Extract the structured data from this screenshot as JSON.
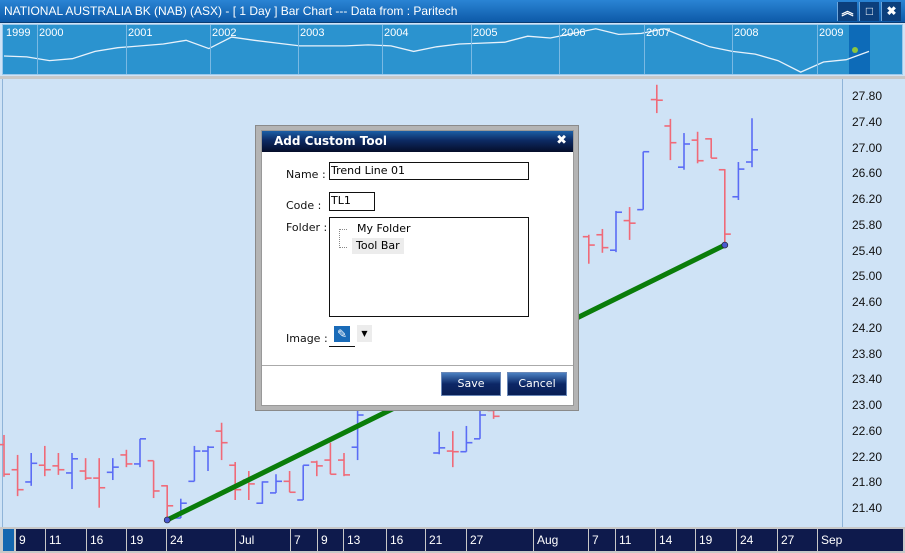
{
  "window": {
    "title": "NATIONAL AUSTRALIA BK (NAB) (ASX) -  [ 1 Day ] Bar Chart --- Data from : Paritech",
    "buttons": [
      {
        "name": "collapse-button",
        "icon": "double-chevron-up-icon",
        "glyph": "⌃"
      },
      {
        "name": "maximize-button",
        "icon": "maximize-icon",
        "glyph": "□"
      },
      {
        "name": "close-button",
        "icon": "close-icon",
        "glyph": "✖"
      }
    ]
  },
  "overview": {
    "years": [
      "1999",
      "2000",
      "2001",
      "2002",
      "2003",
      "2004",
      "2005",
      "2006",
      "2007",
      "2008",
      "2009"
    ],
    "line_color": "#e8f2fb",
    "marker_color": "#8cc63f",
    "levels": [
      37,
      35,
      27,
      31,
      47,
      55,
      59,
      63,
      71,
      53,
      78,
      71,
      65,
      59,
      59,
      59,
      61,
      59,
      47,
      57,
      63,
      65,
      67,
      80,
      76,
      86,
      96,
      84,
      86,
      96,
      76,
      57,
      47,
      41,
      27,
      2,
      24,
      29,
      47
    ]
  },
  "price_axis": [
    "27.80",
    "27.40",
    "27.00",
    "26.60",
    "26.20",
    "25.80",
    "25.40",
    "25.00",
    "24.60",
    "24.20",
    "23.80",
    "23.40",
    "23.00",
    "22.60",
    "22.20",
    "21.80",
    "21.40"
  ],
  "date_axis": [
    "9",
    "11",
    "16",
    "19",
    "24",
    "Jul",
    "7",
    "9",
    "13",
    "16",
    "21",
    "27",
    "Aug",
    "7",
    "11",
    "14",
    "19",
    "24",
    "27",
    "Sep"
  ],
  "chart_data": {
    "type": "ohlc-bar",
    "up_color": "#5b6cf5",
    "down_color": "#f06a78",
    "ylim": [
      21.2,
      28.0
    ],
    "bars": [
      {
        "o": 22.4,
        "h": 22.55,
        "l": 21.9,
        "c": 21.94
      },
      {
        "o": 22.01,
        "h": 22.24,
        "l": 21.6,
        "c": 21.7
      },
      {
        "o": 21.82,
        "h": 22.27,
        "l": 21.76,
        "c": 22.11
      },
      {
        "o": 22.08,
        "h": 22.38,
        "l": 21.91,
        "c": 22.01
      },
      {
        "o": 22.07,
        "h": 22.27,
        "l": 21.93,
        "c": 22.01
      },
      {
        "o": 21.96,
        "h": 22.27,
        "l": 21.71,
        "c": 22.18
      },
      {
        "o": 21.99,
        "h": 22.19,
        "l": 21.85,
        "c": 21.88
      },
      {
        "o": 21.88,
        "h": 22.19,
        "l": 21.42,
        "c": 21.73
      },
      {
        "o": 21.97,
        "h": 22.19,
        "l": 21.85,
        "c": 22.05
      },
      {
        "o": 22.24,
        "h": 22.32,
        "l": 22.05,
        "c": 22.1
      },
      {
        "o": 22.1,
        "h": 22.49,
        "l": 22.05,
        "c": 22.49
      },
      {
        "o": 22.15,
        "h": 22.15,
        "l": 21.57,
        "c": 21.68
      },
      {
        "o": 21.76,
        "h": 21.77,
        "l": 21.23,
        "c": 21.45
      },
      {
        "o": 21.26,
        "h": 21.56,
        "l": 21.26,
        "c": 21.49
      },
      {
        "o": 21.83,
        "h": 22.38,
        "l": 21.83,
        "c": 22.3
      },
      {
        "o": 22.3,
        "h": 22.38,
        "l": 21.99,
        "c": 22.36
      },
      {
        "o": 22.61,
        "h": 22.74,
        "l": 22.16,
        "c": 22.43
      },
      {
        "o": 22.08,
        "h": 22.13,
        "l": 21.54,
        "c": 21.7
      },
      {
        "o": 21.85,
        "h": 21.99,
        "l": 21.54,
        "c": 21.79
      },
      {
        "o": 21.49,
        "h": 21.83,
        "l": 21.48,
        "c": 21.82
      },
      {
        "o": 21.65,
        "h": 21.94,
        "l": 21.65,
        "c": 21.83
      },
      {
        "o": 21.83,
        "h": 21.99,
        "l": 21.66,
        "c": 21.66
      },
      {
        "o": 21.54,
        "h": 22.08,
        "l": 21.54,
        "c": 22.08
      },
      {
        "o": 22.13,
        "h": 22.15,
        "l": 21.91,
        "c": 22.07
      },
      {
        "o": 22.16,
        "h": 22.43,
        "l": 21.94,
        "c": 21.94
      },
      {
        "o": 22.16,
        "h": 22.27,
        "l": 21.91,
        "c": 21.93
      },
      {
        "o": 22.36,
        "h": 23.02,
        "l": 22.16,
        "c": 22.86
      },
      null,
      null,
      null,
      null,
      null,
      {
        "o": 22.27,
        "h": 22.6,
        "l": 22.25,
        "c": 22.35
      },
      {
        "o": 22.3,
        "h": 22.61,
        "l": 22.05,
        "c": 22.29
      },
      {
        "o": 22.29,
        "h": 22.69,
        "l": 22.29,
        "c": 22.43
      },
      {
        "o": 22.49,
        "h": 23.02,
        "l": 22.49,
        "c": 22.86
      },
      {
        "o": 22.93,
        "h": 22.95,
        "l": 22.8,
        "c": 22.84
      },
      null,
      null,
      null,
      null,
      null,
      null,
      {
        "o": 25.63,
        "h": 25.66,
        "l": 25.21,
        "c": 25.5
      },
      {
        "o": 25.66,
        "h": 25.75,
        "l": 25.38,
        "c": 25.46
      },
      {
        "o": 25.42,
        "h": 26.03,
        "l": 25.39,
        "c": 26.01
      },
      {
        "o": 25.88,
        "h": 26.09,
        "l": 25.58,
        "c": 25.84
      },
      {
        "o": 26.05,
        "h": 26.95,
        "l": 26.05,
        "c": 26.95
      },
      {
        "o": 27.76,
        "h": 27.99,
        "l": 27.55,
        "c": 27.75
      },
      {
        "o": 27.35,
        "h": 27.46,
        "l": 26.82,
        "c": 27.09
      },
      {
        "o": 26.71,
        "h": 27.24,
        "l": 26.67,
        "c": 27.07
      },
      {
        "o": 27.13,
        "h": 27.26,
        "l": 26.77,
        "c": 26.81
      },
      {
        "o": 27.15,
        "h": 27.16,
        "l": 26.85,
        "c": 26.85
      },
      {
        "o": 26.67,
        "h": 26.68,
        "l": 25.5,
        "c": 25.67
      },
      {
        "o": 26.25,
        "h": 26.79,
        "l": 26.2,
        "c": 26.68
      },
      {
        "o": 26.79,
        "h": 27.47,
        "l": 26.71,
        "c": 26.98
      }
    ],
    "trend_line": {
      "start": {
        "bar": 12,
        "price": 21.23
      },
      "end": {
        "bar": 53,
        "price": 25.5
      },
      "color": "#0a7d0a"
    }
  },
  "dialog": {
    "title": "Add Custom Tool",
    "name_label": "Name :",
    "name_value": "Trend Line 01",
    "code_label": "Code :",
    "code_value": "TL1",
    "folder_label": "Folder :",
    "folders": [
      "My Folder",
      "Tool Bar"
    ],
    "selected_folder": "Tool Bar",
    "image_label": "Image :",
    "image_icon": "pencil-icon",
    "save_label": "Save",
    "cancel_label": "Cancel"
  }
}
